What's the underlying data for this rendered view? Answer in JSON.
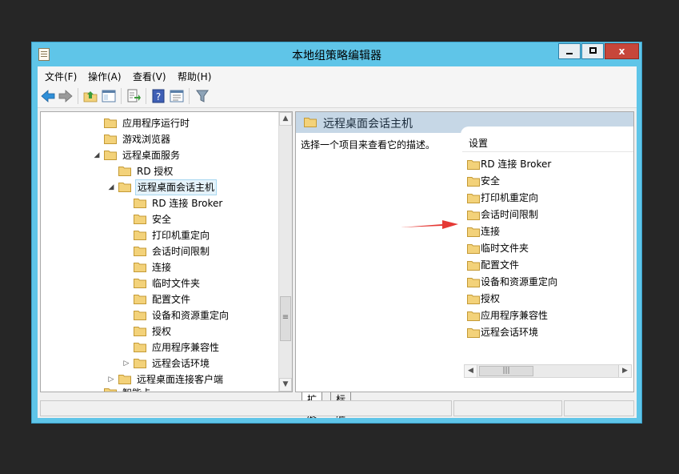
{
  "window": {
    "title": "本地组策略编辑器",
    "close_glyph": "x"
  },
  "colors": {
    "title_bar": "#5fc5e8",
    "close_button": "#c7463a",
    "folder": "#f3d27a",
    "pane_header": "#c6d7e6",
    "arrow": "#e53935"
  },
  "menu": {
    "items": [
      {
        "label": "文件(F)"
      },
      {
        "label": "操作(A)"
      },
      {
        "label": "查看(V)"
      },
      {
        "label": "帮助(H)"
      }
    ]
  },
  "toolbar": {
    "icons": [
      "back-icon",
      "forward-icon",
      "up-folder-icon",
      "show-hide-tree-icon",
      "export-list-icon",
      "help-icon",
      "properties-icon",
      "filter-icon"
    ]
  },
  "tree": {
    "items": [
      {
        "label": "应用程序运行时",
        "level": 4,
        "expander": ""
      },
      {
        "label": "游戏浏览器",
        "level": 4,
        "expander": ""
      },
      {
        "label": "远程桌面服务",
        "level": 4,
        "expander": "◢"
      },
      {
        "label": "RD 授权",
        "level": 5,
        "expander": ""
      },
      {
        "label": "远程桌面会话主机",
        "level": 5,
        "expander": "◢",
        "selected": true
      },
      {
        "label": "RD 连接 Broker",
        "level": 6,
        "expander": ""
      },
      {
        "label": "安全",
        "level": 6,
        "expander": ""
      },
      {
        "label": "打印机重定向",
        "level": 6,
        "expander": ""
      },
      {
        "label": "会话时间限制",
        "level": 6,
        "expander": ""
      },
      {
        "label": "连接",
        "level": 6,
        "expander": ""
      },
      {
        "label": "临时文件夹",
        "level": 6,
        "expander": ""
      },
      {
        "label": "配置文件",
        "level": 6,
        "expander": ""
      },
      {
        "label": "设备和资源重定向",
        "level": 6,
        "expander": ""
      },
      {
        "label": "授权",
        "level": 6,
        "expander": ""
      },
      {
        "label": "应用程序兼容性",
        "level": 6,
        "expander": ""
      },
      {
        "label": "远程会话环境",
        "level": 6,
        "expander": "▷"
      },
      {
        "label": "远程桌面连接客户端",
        "level": 5,
        "expander": "▷"
      },
      {
        "label": "智能卡",
        "level": 4,
        "expander": ""
      }
    ]
  },
  "right_pane": {
    "title": "远程桌面会话主机",
    "description": "选择一个项目来查看它的描述。",
    "column_header": "设置",
    "items": [
      {
        "label": "RD 连接 Broker"
      },
      {
        "label": "安全"
      },
      {
        "label": "打印机重定向"
      },
      {
        "label": "会话时间限制"
      },
      {
        "label": "连接"
      },
      {
        "label": "临时文件夹"
      },
      {
        "label": "配置文件"
      },
      {
        "label": "设备和资源重定向"
      },
      {
        "label": "授权"
      },
      {
        "label": "应用程序兼容性"
      },
      {
        "label": "远程会话环境"
      }
    ]
  },
  "tabs": [
    {
      "label": "扩展",
      "active": true
    },
    {
      "label": "标准",
      "active": false
    }
  ]
}
